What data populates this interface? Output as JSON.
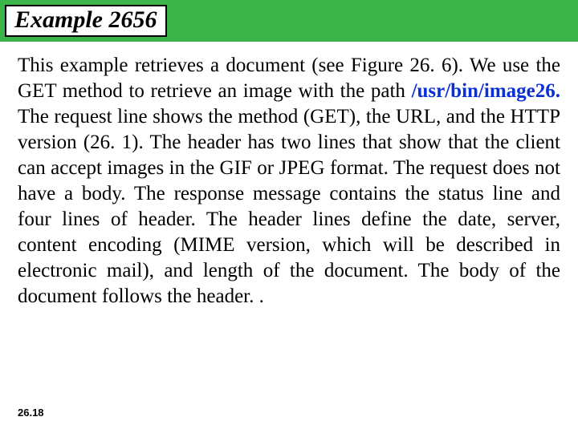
{
  "header": {
    "title": "Example 2656"
  },
  "content": {
    "pre_path": "This example retrieves a document (see Figure 26. 6). We use the GET method to retrieve an image with the path ",
    "path": "/usr/bin/image26.",
    "post_path": " The request line shows the method (GET), the URL, and the HTTP version (26. 1). The header has two lines that show that the client can accept images in the GIF or JPEG format. The request does not have a body. The response message contains the status line and four lines of header. The header lines define the date, server, content encoding (MIME version, which will be described in electronic mail), and length of the document. The body of the document follows the header. ."
  },
  "footer": {
    "page_number": "26.18"
  }
}
